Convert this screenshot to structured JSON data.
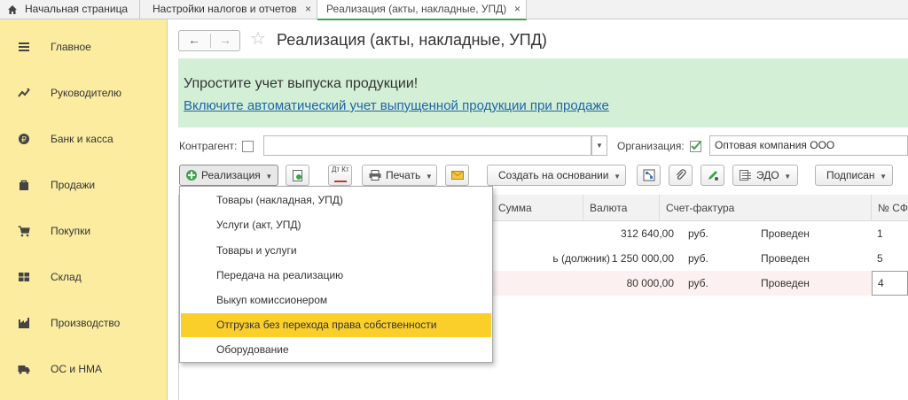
{
  "tabs": [
    {
      "label": "Начальная страница"
    },
    {
      "label": "Настройки налогов и отчетов",
      "close": "×"
    },
    {
      "label": "Реализация (акты, накладные, УПД)",
      "close": "×"
    }
  ],
  "sidebar": {
    "items": [
      {
        "label": "Главное",
        "icon": "menu-lines-icon"
      },
      {
        "label": "Руководителю",
        "icon": "trend-chart-icon"
      },
      {
        "label": "Банк и касса",
        "icon": "coin-icon"
      },
      {
        "label": "Продажи",
        "icon": "shopping-bag-icon"
      },
      {
        "label": "Покупки",
        "icon": "shopping-cart-icon"
      },
      {
        "label": "Склад",
        "icon": "warehouse-icon"
      },
      {
        "label": "Производство",
        "icon": "factory-icon"
      },
      {
        "label": "ОС и НМА",
        "icon": "truck-icon"
      }
    ]
  },
  "header": {
    "back": "←",
    "forward": "→",
    "title": "Реализация (акты, накладные, УПД)"
  },
  "banner": {
    "heading": "Упростите учет выпуска продукции!",
    "link": "Включите автоматический учет выпущенной продукции при продаже"
  },
  "filters": {
    "counterparty_label": "Контрагент:",
    "counterparty_checked": false,
    "counterparty_value": "",
    "organization_label": "Организация:",
    "organization_checked": true,
    "organization_value": "Оптовая компания ООО"
  },
  "toolbar": {
    "realization": "Реализация",
    "print": "Печать",
    "create_based_on": "Создать на основании",
    "edo": "ЭДО",
    "signed": "Подписан",
    "dt_kt": "Дт Кт"
  },
  "table": {
    "columns": [
      "Сумма",
      "Валюта",
      "Счет-фактура",
      "№ СФ"
    ],
    "rows": [
      {
        "fragment": "",
        "sum": "312 640,00",
        "currency": "руб.",
        "invoice": "Проведен",
        "sf_num": "1"
      },
      {
        "fragment": "ь (должник)",
        "sum": "1 250 000,00",
        "currency": "руб.",
        "invoice": "Проведен",
        "sf_num": "5"
      },
      {
        "fragment": "",
        "sum": "80 000,00",
        "currency": "руб.",
        "invoice": "Проведен",
        "sf_num": "4"
      }
    ]
  },
  "menu": {
    "items": [
      "Товары (накладная, УПД)",
      "Услуги (акт, УПД)",
      "Товары и услуги",
      "Передача на реализацию",
      "Выкуп комиссионером",
      "Отгрузка без перехода права собственности",
      "Оборудование"
    ],
    "highlighted_index": 5
  },
  "colors": {
    "sidebar_bg": "#fbeca0",
    "banner_bg": "#d3efd6",
    "link": "#1f64a8",
    "highlight": "#fbcf2a",
    "accent_green": "#3fa34d",
    "selected_row": "#fdf0f0"
  }
}
